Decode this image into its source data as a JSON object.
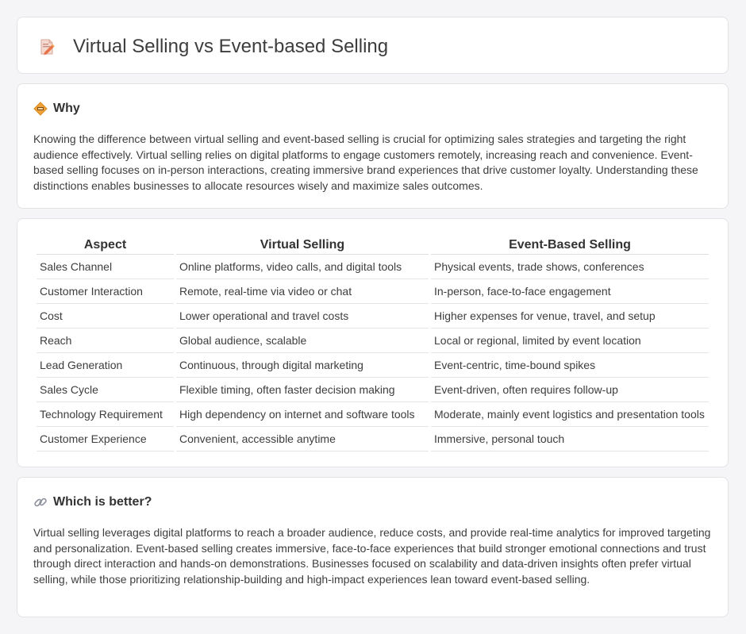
{
  "header": {
    "title": "Virtual Selling vs Event-based Selling",
    "icon": "document-pencil-icon"
  },
  "why": {
    "heading": "Why",
    "icon": "diamond-sign-icon",
    "body": "Knowing the difference between virtual selling and event-based selling is crucial for optimizing sales strategies and targeting the right audience effectively. Virtual selling relies on digital platforms to engage customers remotely, increasing reach and convenience. Event-based selling focuses on in-person interactions, creating immersive brand experiences that drive customer loyalty. Understanding these distinctions enables businesses to allocate resources wisely and maximize sales outcomes."
  },
  "table": {
    "headers": [
      "Aspect",
      "Virtual Selling",
      "Event-Based Selling"
    ],
    "rows": [
      [
        "Sales Channel",
        "Online platforms, video calls, and digital tools",
        "Physical events, trade shows, conferences"
      ],
      [
        "Customer Interaction",
        "Remote, real-time via video or chat",
        "In-person, face-to-face engagement"
      ],
      [
        "Cost",
        "Lower operational and travel costs",
        "Higher expenses for venue, travel, and setup"
      ],
      [
        "Reach",
        "Global audience, scalable",
        "Local or regional, limited by event location"
      ],
      [
        "Lead Generation",
        "Continuous, through digital marketing",
        "Event-centric, time-bound spikes"
      ],
      [
        "Sales Cycle",
        "Flexible timing, often faster decision making",
        "Event-driven, often requires follow-up"
      ],
      [
        "Technology Requirement",
        "High dependency on internet and software tools",
        "Moderate, mainly event logistics and presentation tools"
      ],
      [
        "Customer Experience",
        "Convenient, accessible anytime",
        "Immersive, personal touch"
      ]
    ]
  },
  "better": {
    "heading": "Which is better?",
    "icon": "link-icon",
    "body": "Virtual selling leverages digital platforms to reach a broader audience, reduce costs, and provide real-time analytics for improved targeting and personalization. Event-based selling creates immersive, face-to-face experiences that build stronger emotional connections and trust through direct interaction and hands-on demonstrations. Businesses focused on scalability and data-driven insights often prefer virtual selling, while those prioritizing relationship-building and high-impact experiences lean toward event-based selling."
  }
}
